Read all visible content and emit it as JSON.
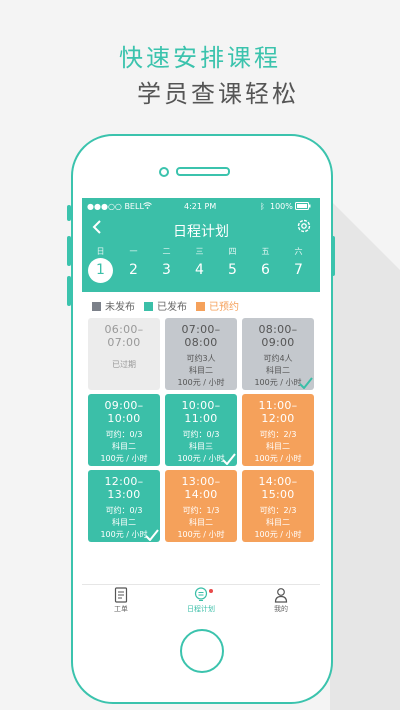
{
  "headline": {
    "line1": "快速安排课程",
    "line2": "学员查课轻松"
  },
  "status": {
    "carrier": "●●●○○ BELL",
    "time": "4:21 PM",
    "battery": "100%"
  },
  "nav": {
    "title": "日程计划"
  },
  "week": [
    {
      "day": "日",
      "date": "1",
      "selected": true
    },
    {
      "day": "一",
      "date": "2"
    },
    {
      "day": "二",
      "date": "3"
    },
    {
      "day": "三",
      "date": "4"
    },
    {
      "day": "四",
      "date": "5"
    },
    {
      "day": "五",
      "date": "6"
    },
    {
      "day": "六",
      "date": "7"
    }
  ],
  "legend": [
    {
      "label": "未发布",
      "color": "#7b8089"
    },
    {
      "label": "已发布",
      "color": "#3bbfa8"
    },
    {
      "label": "已预约",
      "color": "#f5a15b"
    }
  ],
  "slots": [
    {
      "time": "06:00–07:00",
      "line1": "已过期",
      "line2": "",
      "line3": "",
      "state": "past"
    },
    {
      "time": "07:00–08:00",
      "line1": "可约3人",
      "line2": "科目二",
      "line3": "100元 / 小时",
      "state": "unpub"
    },
    {
      "time": "08:00–09:00",
      "line1": "可约4人",
      "line2": "科目二",
      "line3": "100元 / 小时",
      "state": "unpub",
      "checked": true
    },
    {
      "time": "09:00–10:00",
      "line1": "可约：0/3",
      "line2": "科目二",
      "line3": "100元 / 小时",
      "state": "pub"
    },
    {
      "time": "10:00–11:00",
      "line1": "可约：0/3",
      "line2": "科目三",
      "line3": "100元 / 小时",
      "state": "pub",
      "checked": true
    },
    {
      "time": "11:00–12:00",
      "line1": "可约：2/3",
      "line2": "科目二",
      "line3": "100元 / 小时",
      "state": "booked"
    },
    {
      "time": "12:00–13:00",
      "line1": "可约：0/3",
      "line2": "科目二",
      "line3": "100元 / 小时",
      "state": "pub",
      "checked": true
    },
    {
      "time": "13:00–14:00",
      "line1": "可约：1/3",
      "line2": "科目二",
      "line3": "100元 / 小时",
      "state": "booked"
    },
    {
      "time": "14:00–15:00",
      "line1": "可约：2/3",
      "line2": "科目二",
      "line3": "100元 / 小时",
      "state": "booked"
    }
  ],
  "tabs": [
    {
      "label": "工单",
      "icon": "document-icon"
    },
    {
      "label": "日程计划",
      "icon": "calendar-bulb-icon",
      "active": true,
      "badge": true
    },
    {
      "label": "我的",
      "icon": "person-icon"
    }
  ],
  "colors": {
    "accent": "#3bbfa8",
    "booked": "#f5a15b",
    "unpublished": "#c4c8cd",
    "past": "#ececec"
  }
}
